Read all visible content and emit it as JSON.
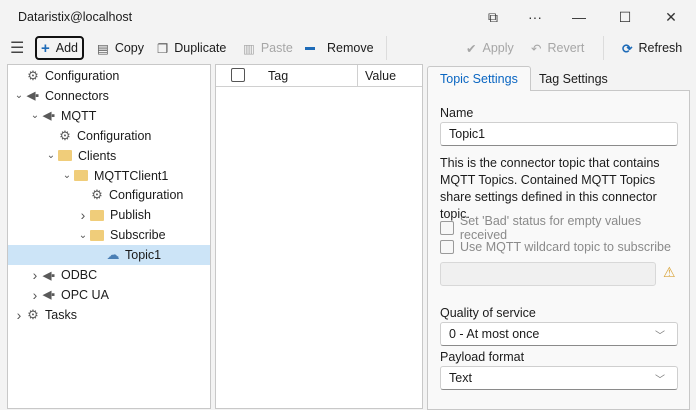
{
  "window": {
    "title": "Dataristix@localhost",
    "controls": [
      "⧉",
      "···",
      "—",
      "☐",
      "✕"
    ]
  },
  "toolbar": {
    "add": "Add",
    "copy": "Copy",
    "duplicate": "Duplicate",
    "paste": "Paste",
    "remove": "Remove",
    "apply": "Apply",
    "revert": "Revert",
    "refresh": "Refresh"
  },
  "tree": [
    {
      "label": "Configuration",
      "level": 0,
      "icon": "gear",
      "chev": ""
    },
    {
      "label": "Connectors",
      "level": 0,
      "icon": "plug",
      "chev": "v"
    },
    {
      "label": "MQTT",
      "level": 1,
      "icon": "plug",
      "chev": "v"
    },
    {
      "label": "Configuration",
      "level": 2,
      "icon": "gear",
      "chev": ""
    },
    {
      "label": "Clients",
      "level": 2,
      "icon": "folder",
      "chev": "v"
    },
    {
      "label": "MQTTClient1",
      "level": 3,
      "icon": "folder",
      "chev": "v"
    },
    {
      "label": "Configuration",
      "level": 4,
      "icon": "gear",
      "chev": ""
    },
    {
      "label": "Publish",
      "level": 4,
      "icon": "folder",
      "chev": ">"
    },
    {
      "label": "Subscribe",
      "level": 4,
      "icon": "folder",
      "chev": "v"
    },
    {
      "label": "Topic1",
      "level": 5,
      "icon": "cloud",
      "chev": "",
      "selected": true
    },
    {
      "label": "ODBC",
      "level": 1,
      "icon": "plug",
      "chev": ">"
    },
    {
      "label": "OPC UA",
      "level": 1,
      "icon": "plug",
      "chev": ">"
    },
    {
      "label": "Tasks",
      "level": 0,
      "icon": "gears",
      "chev": ">"
    }
  ],
  "table": {
    "columns": [
      "Tag",
      "Value"
    ]
  },
  "tabs": {
    "topic": "Topic Settings",
    "tag": "Tag Settings"
  },
  "form": {
    "name_label": "Name",
    "name_value": "Topic1",
    "description": "This is the connector topic that contains MQTT Topics. Contained MQTT Topics share settings defined in this connector topic.",
    "bad_status": "Set 'Bad' status for empty values received",
    "wildcard": "Use MQTT wildcard topic to subscribe",
    "wildcard_value": "",
    "qos_label": "Quality of service",
    "qos_value": "0 - At most once",
    "payload_label": "Payload format",
    "payload_value": "Text"
  },
  "colors": {
    "accent": "#0a66c2",
    "selection": "#cce4f7",
    "folder": "#f0cd7a"
  }
}
